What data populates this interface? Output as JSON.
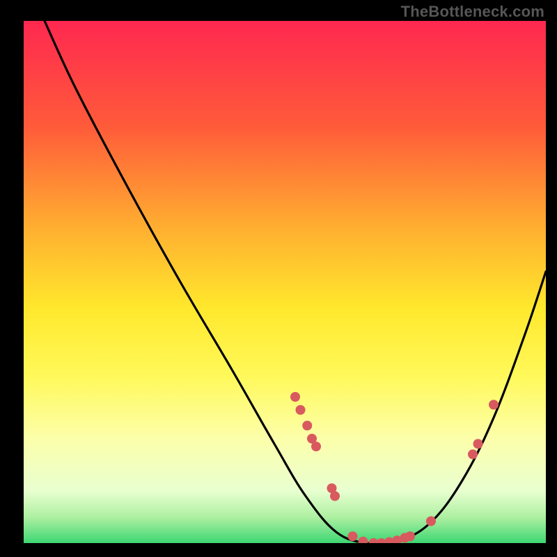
{
  "watermark": "TheBottleneck.com",
  "chart_data": {
    "type": "line",
    "title": "",
    "xlabel": "",
    "ylabel": "",
    "xlim": [
      0,
      100
    ],
    "ylim": [
      0,
      100
    ],
    "background": {
      "type": "vertical_gradient",
      "stops": [
        {
          "y": 0,
          "color": "#ff2850"
        },
        {
          "y": 20,
          "color": "#ff5a3a"
        },
        {
          "y": 40,
          "color": "#ffb030"
        },
        {
          "y": 55,
          "color": "#ffe82c"
        },
        {
          "y": 68,
          "color": "#fff95a"
        },
        {
          "y": 80,
          "color": "#fcffaa"
        },
        {
          "y": 90,
          "color": "#e9ffd0"
        },
        {
          "y": 95,
          "color": "#aef0a2"
        },
        {
          "y": 100,
          "color": "#3dd673"
        }
      ]
    },
    "series": [
      {
        "name": "bottleneck-curve",
        "stroke": "#000000",
        "points": [
          {
            "x": 4,
            "y": 100
          },
          {
            "x": 10,
            "y": 87
          },
          {
            "x": 20,
            "y": 68
          },
          {
            "x": 30,
            "y": 50
          },
          {
            "x": 40,
            "y": 33
          },
          {
            "x": 48,
            "y": 19
          },
          {
            "x": 54,
            "y": 9
          },
          {
            "x": 60,
            "y": 2
          },
          {
            "x": 66,
            "y": 0
          },
          {
            "x": 72,
            "y": 0.5
          },
          {
            "x": 78,
            "y": 4
          },
          {
            "x": 84,
            "y": 12
          },
          {
            "x": 90,
            "y": 24
          },
          {
            "x": 96,
            "y": 40
          },
          {
            "x": 100,
            "y": 52
          }
        ]
      }
    ],
    "markers": {
      "color": "#d85a5f",
      "radius_px": 7,
      "points": [
        {
          "x": 52.0,
          "y": 28.0
        },
        {
          "x": 53.0,
          "y": 25.5
        },
        {
          "x": 54.3,
          "y": 22.5
        },
        {
          "x": 55.2,
          "y": 20.0
        },
        {
          "x": 56.0,
          "y": 18.5
        },
        {
          "x": 59.0,
          "y": 10.5
        },
        {
          "x": 59.6,
          "y": 9.0
        },
        {
          "x": 63.0,
          "y": 1.3
        },
        {
          "x": 65.0,
          "y": 0.3
        },
        {
          "x": 67.0,
          "y": 0.0
        },
        {
          "x": 68.5,
          "y": 0.0
        },
        {
          "x": 70.0,
          "y": 0.2
        },
        {
          "x": 71.5,
          "y": 0.5
        },
        {
          "x": 73.0,
          "y": 1.0
        },
        {
          "x": 74.0,
          "y": 1.3
        },
        {
          "x": 78.0,
          "y": 4.2
        },
        {
          "x": 86.0,
          "y": 17.0
        },
        {
          "x": 87.0,
          "y": 19.0
        },
        {
          "x": 90.0,
          "y": 26.5
        }
      ]
    }
  }
}
